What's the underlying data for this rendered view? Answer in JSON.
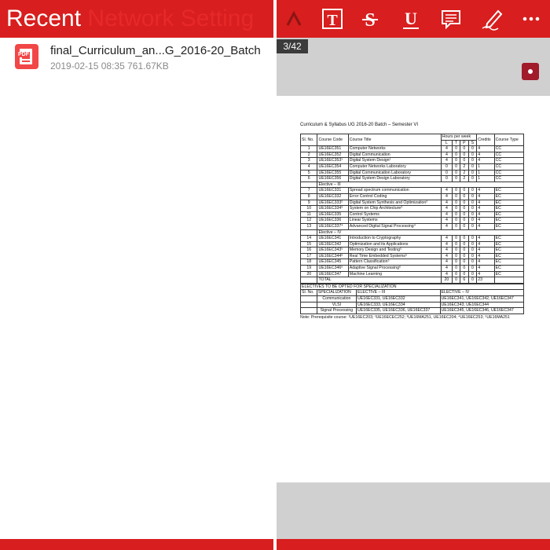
{
  "left_panel": {
    "title": "Recent",
    "ghost_title": " Network Setting",
    "files": [
      {
        "name": "final_Curriculum_an...G_2016-20_Batch",
        "date": "2019-02-15 08:35",
        "size": "761.67KB",
        "icon": "pdf-file-icon",
        "icon_label": "PDF"
      }
    ]
  },
  "reader": {
    "toolbar_icons": [
      "highlight-caret-icon",
      "text-box-icon",
      "strikethrough-icon",
      "underline-icon",
      "comment-icon",
      "pen-icon",
      "more-icon"
    ],
    "page_indicator": "3/42",
    "accent_color": "#d81e1e"
  },
  "document": {
    "title": "Curriculum & Syllabus UG 2016-20 Batch – Semester VI",
    "headers": {
      "slno": "Sl. No.",
      "code": "Course Code",
      "course_title": "Course Title",
      "hours": "Hours per week",
      "l": "L",
      "t": "T",
      "p": "P",
      "s": "S",
      "credits": "Credits",
      "type": "Course Type"
    },
    "rows1": [
      {
        "no": "1",
        "code": "UE16EC351",
        "title": "Computer Networks",
        "l": "4",
        "t": "0",
        "p": "0",
        "s": "0",
        "cr": "4",
        "type": "CC"
      },
      {
        "no": "2",
        "code": "UE16EC352",
        "title": "Digital Communication",
        "l": "4",
        "t": "0",
        "p": "0",
        "s": "0",
        "cr": "4",
        "type": "CC"
      },
      {
        "no": "3",
        "code": "UE16EC353¹",
        "title": "Digital System Design¹",
        "l": "4",
        "t": "0",
        "p": "0",
        "s": "0",
        "cr": "4",
        "type": "CC"
      },
      {
        "no": "4",
        "code": "UE16EC354",
        "title": "Computer Networks Laboratory",
        "l": "0",
        "t": "0",
        "p": "2",
        "s": "0",
        "cr": "1",
        "type": "CC"
      },
      {
        "no": "5",
        "code": "UE16EC355",
        "title": "Digital Communication Laboratory",
        "l": "0",
        "t": "0",
        "p": "2",
        "s": "0",
        "cr": "1",
        "type": "CC"
      },
      {
        "no": "6",
        "code": "UE16EC356",
        "title": "Digital System Design Laboratory",
        "l": "0",
        "t": "0",
        "p": "2",
        "s": "0",
        "cr": "1",
        "type": "CC"
      }
    ],
    "elective3_label": "Elective – III",
    "rows2": [
      {
        "no": "7",
        "code": "UE16EC331",
        "title": "Spread spectrum communication",
        "l": "4",
        "t": "0",
        "p": "0",
        "s": "0",
        "cr": "4",
        "type": "EC"
      },
      {
        "no": "8",
        "code": "UE16EC332",
        "title": "Error Control Coding",
        "l": "4",
        "t": "0",
        "p": "0",
        "s": "0",
        "cr": "4",
        "type": "EC"
      },
      {
        "no": "9",
        "code": "UE16EC333²",
        "title": "Digital System Synthesis and Optimization²",
        "l": "4",
        "t": "0",
        "p": "0",
        "s": "0",
        "cr": "4",
        "type": "EC"
      },
      {
        "no": "10",
        "code": "UE16EC334³",
        "title": "System on Chip Architecture³",
        "l": "4",
        "t": "0",
        "p": "0",
        "s": "0",
        "cr": "4",
        "type": "EC"
      },
      {
        "no": "11",
        "code": "UE16EC335",
        "title": "Control Systems",
        "l": "4",
        "t": "0",
        "p": "0",
        "s": "0",
        "cr": "4",
        "type": "EC"
      },
      {
        "no": "12",
        "code": "UE16EC336",
        "title": "Linear Systems",
        "l": "4",
        "t": "0",
        "p": "0",
        "s": "0",
        "cr": "4",
        "type": "EC"
      },
      {
        "no": "13",
        "code": "UE16EC337⁴",
        "title": "Advanced Digital Signal Processing⁴",
        "l": "4",
        "t": "0",
        "p": "0",
        "s": "0",
        "cr": "4",
        "type": "EC"
      }
    ],
    "elective4_label": "Elective – IV",
    "rows3": [
      {
        "no": "14",
        "code": "UE16EC341",
        "title": "Introduction to Cryptography",
        "l": "4",
        "t": "0",
        "p": "0",
        "s": "0",
        "cr": "4",
        "type": "EC"
      },
      {
        "no": "15",
        "code": "UE16EC342",
        "title": "Optimization and its Applications",
        "l": "4",
        "t": "0",
        "p": "0",
        "s": "0",
        "cr": "4",
        "type": "EC"
      },
      {
        "no": "16",
        "code": "UE16EC343⁵",
        "title": "Memory Design and Testing⁵",
        "l": "4",
        "t": "0",
        "p": "0",
        "s": "0",
        "cr": "4",
        "type": "EC"
      },
      {
        "no": "17",
        "code": "UE16EC344⁶",
        "title": "Real Time Embedded Systems⁶",
        "l": "4",
        "t": "0",
        "p": "0",
        "s": "0",
        "cr": "4",
        "type": "EC"
      },
      {
        "no": "18",
        "code": "UE16EC345",
        "title": "Pattern Classification⁵",
        "l": "4",
        "t": "0",
        "p": "0",
        "s": "0",
        "cr": "4",
        "type": "EC"
      },
      {
        "no": "19",
        "code": "UE16EC346⁶",
        "title": "Adaptive Signal Processing⁶",
        "l": "4",
        "t": "0",
        "p": "0",
        "s": "0",
        "cr": "4",
        "type": "EC"
      },
      {
        "no": "20",
        "code": "UE16EC347",
        "title": "Machine Learning",
        "l": "4",
        "t": "0",
        "p": "0",
        "s": "0",
        "cr": "4",
        "type": "EC"
      }
    ],
    "total": {
      "label": "TOTAL",
      "l": "20",
      "t": "0",
      "p": "6",
      "s": "0",
      "cr": "23"
    },
    "spec_title": "ELECTIVES TO BE OPTED FOR SPECIALIZATION",
    "spec_headers": {
      "no": "Sl. No.",
      "spec": "SPECIALIZATION",
      "e3": "ELECTIVE – III",
      "e4": "ELECTIVE – IV"
    },
    "spec_rows": [
      {
        "spec": "Communication",
        "e3": "UE16EC331, UE16EC332",
        "e4": "UE16EC341, UE16EC342, UE16EC347"
      },
      {
        "spec": "VLSI",
        "e3": "UE16EC333, UE16EC334",
        "e4": "UE16EC343, UE16EC344"
      },
      {
        "spec": "Signal Processing",
        "e3": "UE16EC335, UE16EC336, UE16EC337",
        "e4": "UE16EC345, UE16EC346, UE16EC347"
      }
    ],
    "note": "Note: Prerequisite course: ¹UE16EC203; ²UE16ECEC252; ³UE16MA251, UE16EC204; ⁴UE16EC253; ⁵UE16MA251"
  }
}
